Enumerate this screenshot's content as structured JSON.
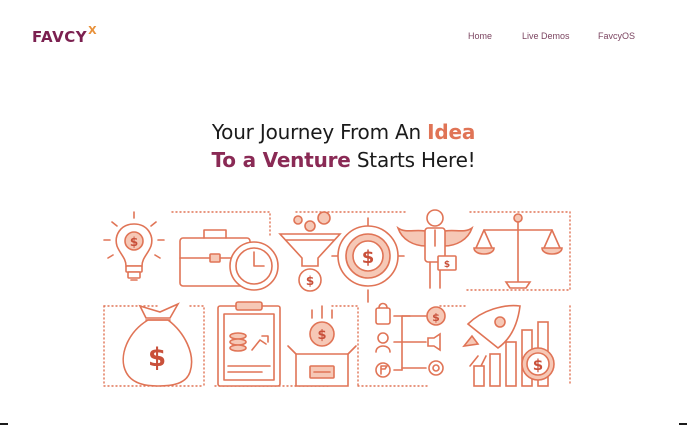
{
  "brand": {
    "name": "FAVCY",
    "mark": "X"
  },
  "nav": {
    "items": [
      {
        "label": "Home"
      },
      {
        "label": "Live Demos"
      },
      {
        "label": "FavcyOS"
      }
    ]
  },
  "hero": {
    "line1_prefix": "Your Journey From An ",
    "line1_highlight": "Idea",
    "line2_highlight": "To a Venture",
    "line2_suffix": " Starts Here!"
  },
  "colors": {
    "accent_orange": "#e07456",
    "brand_purple": "#7b2050",
    "text_dark": "#1b1b1b"
  },
  "illustration": {
    "icons": [
      "lightbulb-dollar-icon",
      "briefcase-clock-icon",
      "funnel-coin-icon",
      "target-dollar-icon",
      "angel-investor-icon",
      "balance-scale-icon",
      "money-bag-icon",
      "clipboard-growth-icon",
      "box-dollar-icon",
      "business-flowchart-icon",
      "rocket-growth-chart-icon"
    ]
  }
}
